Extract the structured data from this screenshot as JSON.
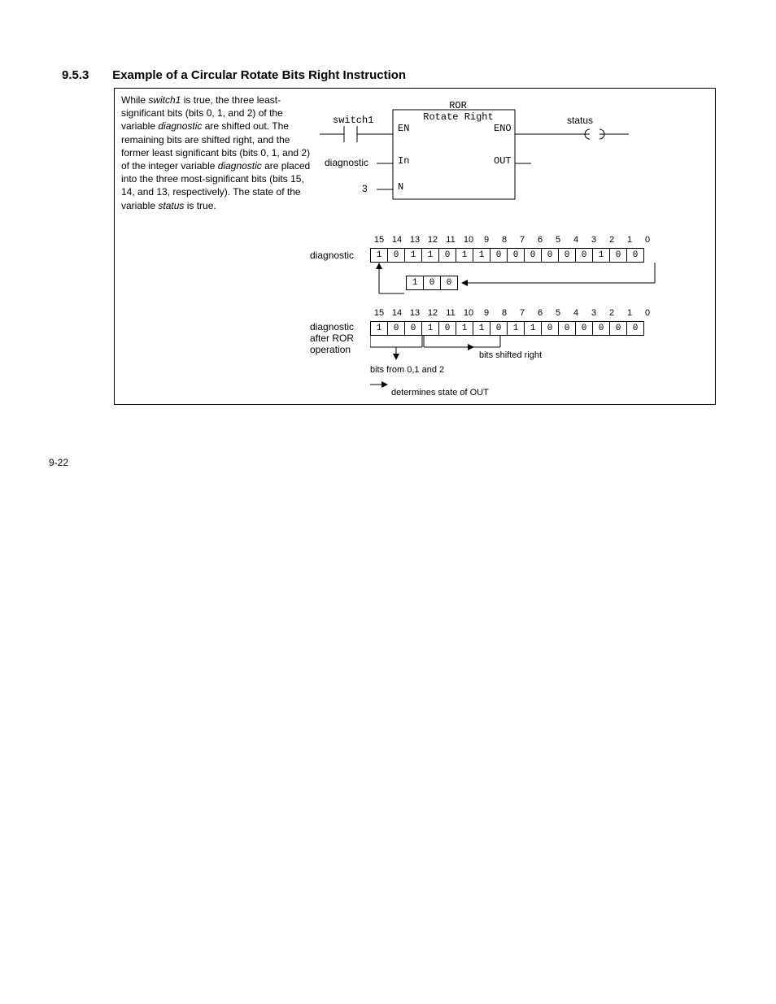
{
  "heading": {
    "num": "9.5.3",
    "title": "Example of a Circular Rotate Bits Right Instruction"
  },
  "page_num": "9-22",
  "desc": {
    "p1a": "While ",
    "sw": "switch1",
    "p1b": " is true, the three least-significant bits (bits 0, 1, and 2) of the variable ",
    "diag": "diagnostic",
    "p1c": " are shifted out. The remaining bits are shifted right, and the former least significant bits (bits 0, 1, and 2) of the integer variable ",
    "p1d": " are placed into the three most-significant bits (bits 15, 14, and 13, respectively). The state of the variable ",
    "stat": "status",
    "p1e": " is true."
  },
  "ladder": {
    "switch": "switch1",
    "diag": "diagnostic",
    "n_val": "3",
    "ror": "ROR",
    "rot": "Rotate Right",
    "en": "EN",
    "eno": "ENO",
    "in": "In",
    "out": "OUT",
    "n": "N",
    "status": "status"
  },
  "bits": {
    "label_diag": "diagnostic",
    "label_after1": "diagnostic",
    "label_after2": "after ROR",
    "label_after3": "operation",
    "nums": [
      "15",
      "14",
      "13",
      "12",
      "11",
      "10",
      "9",
      "8",
      "7",
      "6",
      "5",
      "4",
      "3",
      "2",
      "1",
      "0"
    ],
    "row1": [
      "1",
      "0",
      "1",
      "1",
      "0",
      "1",
      "1",
      "0",
      "0",
      "0",
      "0",
      "0",
      "0",
      "1",
      "0",
      "0"
    ],
    "sub": [
      "1",
      "0",
      "0"
    ],
    "row2": [
      "1",
      "0",
      "0",
      "1",
      "0",
      "1",
      "1",
      "0",
      "1",
      "1",
      "0",
      "0",
      "0",
      "0",
      "0",
      "0"
    ],
    "anno1": "bits from 0,1 and 2",
    "anno2": "bits shifted right",
    "anno3": "determines state of OUT"
  }
}
